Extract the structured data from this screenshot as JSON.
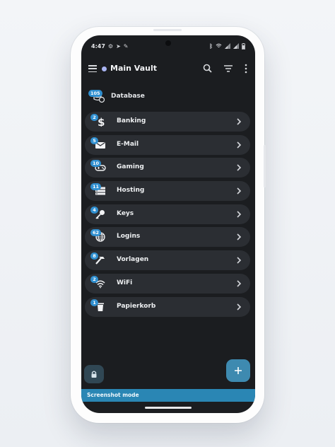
{
  "status_bar": {
    "time": "4:47"
  },
  "app_bar": {
    "title": "Main Vault"
  },
  "database": {
    "label": "Database",
    "count": "105"
  },
  "categories": [
    {
      "label": "Banking",
      "count": "2",
      "icon": "dollar-icon"
    },
    {
      "label": "E-Mail",
      "count": "5",
      "icon": "envelope-icon"
    },
    {
      "label": "Gaming",
      "count": "10",
      "icon": "gamepad-icon"
    },
    {
      "label": "Hosting",
      "count": "11",
      "icon": "server-icon"
    },
    {
      "label": "Keys",
      "count": "4",
      "icon": "key-icon"
    },
    {
      "label": "Logins",
      "count": "62",
      "icon": "globe-icon"
    },
    {
      "label": "Vorlagen",
      "count": "8",
      "icon": "hammer-icon"
    },
    {
      "label": "WiFi",
      "count": "2",
      "icon": "wifi-icon"
    },
    {
      "label": "Papierkorb",
      "count": "1",
      "icon": "trash-icon"
    }
  ],
  "banner": {
    "text": "Screenshot mode"
  },
  "colors": {
    "accent": "#2a86b4",
    "badge": "#2f8fd0",
    "background": "#1b1d20",
    "card": "#2b2e33",
    "vault_dot": "#a9b4f2"
  }
}
